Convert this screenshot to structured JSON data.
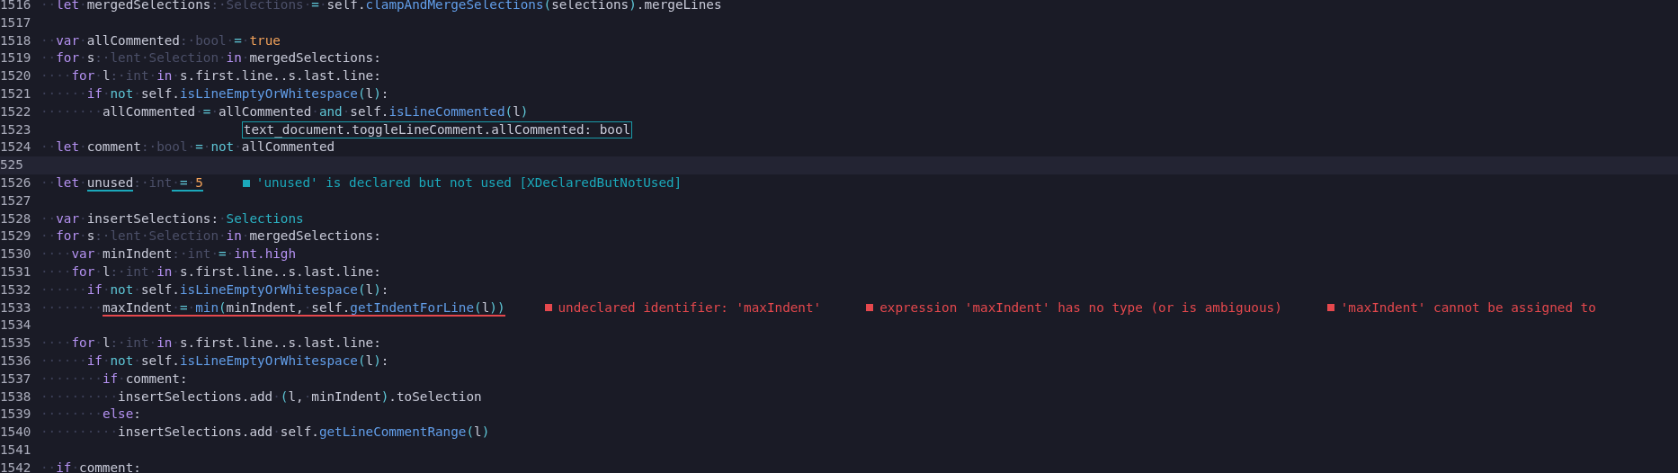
{
  "editor": {
    "lines": [
      {
        "number": "1516",
        "current": false,
        "tokens": [
          {
            "kind": "ws",
            "text": "··"
          },
          {
            "kind": "kw",
            "text": "let"
          },
          {
            "kind": "ws",
            "text": "·"
          },
          {
            "kind": "id",
            "text": "mergedSelections"
          },
          {
            "kind": "type",
            "text": ":·Selections"
          },
          {
            "kind": "ws",
            "text": "·"
          },
          {
            "kind": "op",
            "text": "="
          },
          {
            "kind": "ws",
            "text": "·"
          },
          {
            "kind": "id",
            "text": "self."
          },
          {
            "kind": "fn",
            "text": "clampAndMergeSelections"
          },
          {
            "kind": "op",
            "text": "("
          },
          {
            "kind": "id",
            "text": "selections"
          },
          {
            "kind": "op",
            "text": ")"
          },
          {
            "kind": "id",
            "text": ".mergeLines"
          }
        ]
      },
      {
        "number": "1517",
        "current": false
      },
      {
        "number": "1518",
        "current": false,
        "tokens": [
          {
            "kind": "ws",
            "text": "··"
          },
          {
            "kind": "kw",
            "text": "var"
          },
          {
            "kind": "ws",
            "text": "·"
          },
          {
            "kind": "id",
            "text": "allCommented"
          },
          {
            "kind": "type",
            "text": ":·bool"
          },
          {
            "kind": "ws",
            "text": "·"
          },
          {
            "kind": "op",
            "text": "="
          },
          {
            "kind": "ws",
            "text": "·"
          },
          {
            "kind": "lit",
            "text": "true"
          }
        ]
      },
      {
        "number": "1519",
        "current": false,
        "tokens": [
          {
            "kind": "ws",
            "text": "··"
          },
          {
            "kind": "kw",
            "text": "for"
          },
          {
            "kind": "ws",
            "text": "·"
          },
          {
            "kind": "id",
            "text": "s"
          },
          {
            "kind": "type",
            "text": ":·lent·Selection"
          },
          {
            "kind": "ws",
            "text": "·"
          },
          {
            "kind": "kw",
            "text": "in"
          },
          {
            "kind": "ws",
            "text": "·"
          },
          {
            "kind": "id",
            "text": "mergedSelections:"
          }
        ]
      },
      {
        "number": "1520",
        "current": false,
        "tokens": [
          {
            "kind": "ws",
            "text": "····"
          },
          {
            "kind": "kw",
            "text": "for"
          },
          {
            "kind": "ws",
            "text": "·"
          },
          {
            "kind": "id",
            "text": "l"
          },
          {
            "kind": "type",
            "text": ":·int"
          },
          {
            "kind": "ws",
            "text": "·"
          },
          {
            "kind": "kw",
            "text": "in"
          },
          {
            "kind": "ws",
            "text": "·"
          },
          {
            "kind": "id",
            "text": "s.first.line..s.last.line:"
          }
        ]
      },
      {
        "number": "1521",
        "current": false,
        "tokens": [
          {
            "kind": "ws",
            "text": "······"
          },
          {
            "kind": "kw",
            "text": "if"
          },
          {
            "kind": "ws",
            "text": "·"
          },
          {
            "kind": "op",
            "text": "not"
          },
          {
            "kind": "ws",
            "text": "·"
          },
          {
            "kind": "id",
            "text": "self."
          },
          {
            "kind": "fn",
            "text": "isLineEmptyOrWhitespace"
          },
          {
            "kind": "op",
            "text": "("
          },
          {
            "kind": "id",
            "text": "l"
          },
          {
            "kind": "op",
            "text": ")"
          },
          {
            "kind": "id",
            "text": ":"
          }
        ]
      },
      {
        "number": "1522",
        "current": false,
        "tokens": [
          {
            "kind": "ws",
            "text": "········"
          },
          {
            "kind": "id",
            "text": "allCommented"
          },
          {
            "kind": "ws",
            "text": "·"
          },
          {
            "kind": "op",
            "text": "="
          },
          {
            "kind": "ws",
            "text": "·"
          },
          {
            "kind": "id",
            "text": "allCommented"
          },
          {
            "kind": "ws",
            "text": "·"
          },
          {
            "kind": "op",
            "text": "and"
          },
          {
            "kind": "ws",
            "text": "·"
          },
          {
            "kind": "id",
            "text": "self."
          },
          {
            "kind": "fn",
            "text": "isLineCommented"
          },
          {
            "kind": "op",
            "text": "("
          },
          {
            "kind": "id",
            "text": "l"
          },
          {
            "kind": "op",
            "text": ")"
          }
        ]
      },
      {
        "number": "1523",
        "current": false,
        "hint": "text_document.toggleLineComment.allCommented: bool"
      },
      {
        "number": "1524",
        "current": false,
        "tokens": [
          {
            "kind": "ws",
            "text": "··"
          },
          {
            "kind": "kw",
            "text": "let"
          },
          {
            "kind": "ws",
            "text": "·"
          },
          {
            "kind": "id",
            "text": "comment"
          },
          {
            "kind": "type",
            "text": ":·bool"
          },
          {
            "kind": "ws",
            "text": "·"
          },
          {
            "kind": "op",
            "text": "="
          },
          {
            "kind": "ws",
            "text": "·"
          },
          {
            "kind": "op",
            "text": "not"
          },
          {
            "kind": "ws",
            "text": "·"
          },
          {
            "kind": "id",
            "text": "allCommented"
          }
        ]
      },
      {
        "number": "525",
        "current": true
      },
      {
        "number": "1526",
        "current": false,
        "tokens": [
          {
            "kind": "ws",
            "text": "··",
            "underlined": false
          },
          {
            "kind": "kw",
            "text": "let",
            "underlined": false
          },
          {
            "kind": "ws",
            "text": "·",
            "underlined": false
          },
          {
            "kind": "id",
            "text": "unused",
            "underlined": true
          },
          {
            "kind": "type",
            "text": ":·int",
            "underlined": false
          },
          {
            "kind": "ws",
            "text": "·",
            "underlined": true
          },
          {
            "kind": "op",
            "text": "=",
            "underlined": true
          },
          {
            "kind": "ws",
            "text": "·",
            "underlined": true
          },
          {
            "kind": "lit",
            "text": "5",
            "underlined": true
          }
        ],
        "diagnostics": [
          {
            "kind": "warning",
            "message": "'unused' is declared but not used [XDeclaredButNotUsed]"
          }
        ]
      },
      {
        "number": "1527",
        "current": false
      },
      {
        "number": "1528",
        "current": false,
        "tokens": [
          {
            "kind": "ws",
            "text": "··"
          },
          {
            "kind": "kw",
            "text": "var"
          },
          {
            "kind": "ws",
            "text": "·"
          },
          {
            "kind": "id",
            "text": "insertSelections:"
          },
          {
            "kind": "ws",
            "text": "·"
          },
          {
            "kind": "cls",
            "text": "Selections"
          }
        ]
      },
      {
        "number": "1529",
        "current": false,
        "tokens": [
          {
            "kind": "ws",
            "text": "··"
          },
          {
            "kind": "kw",
            "text": "for"
          },
          {
            "kind": "ws",
            "text": "·"
          },
          {
            "kind": "id",
            "text": "s"
          },
          {
            "kind": "type",
            "text": ":·lent·Selection"
          },
          {
            "kind": "ws",
            "text": "·"
          },
          {
            "kind": "kw",
            "text": "in"
          },
          {
            "kind": "ws",
            "text": "·"
          },
          {
            "kind": "id",
            "text": "mergedSelections:"
          }
        ]
      },
      {
        "number": "1530",
        "current": false,
        "tokens": [
          {
            "kind": "ws",
            "text": "····"
          },
          {
            "kind": "kw",
            "text": "var"
          },
          {
            "kind": "ws",
            "text": "·"
          },
          {
            "kind": "id",
            "text": "minIndent"
          },
          {
            "kind": "type",
            "text": ":·int"
          },
          {
            "kind": "ws",
            "text": "·"
          },
          {
            "kind": "op",
            "text": "="
          },
          {
            "kind": "ws",
            "text": "·"
          },
          {
            "kind": "kw",
            "text": "int.high"
          }
        ]
      },
      {
        "number": "1531",
        "current": false,
        "tokens": [
          {
            "kind": "ws",
            "text": "····"
          },
          {
            "kind": "kw",
            "text": "for"
          },
          {
            "kind": "ws",
            "text": "·"
          },
          {
            "kind": "id",
            "text": "l"
          },
          {
            "kind": "type",
            "text": ":·int"
          },
          {
            "kind": "ws",
            "text": "·"
          },
          {
            "kind": "kw",
            "text": "in"
          },
          {
            "kind": "ws",
            "text": "·"
          },
          {
            "kind": "id",
            "text": "s.first.line..s.last.line:"
          }
        ]
      },
      {
        "number": "1532",
        "current": false,
        "tokens": [
          {
            "kind": "ws",
            "text": "······"
          },
          {
            "kind": "kw",
            "text": "if"
          },
          {
            "kind": "ws",
            "text": "·"
          },
          {
            "kind": "op",
            "text": "not"
          },
          {
            "kind": "ws",
            "text": "·"
          },
          {
            "kind": "id",
            "text": "self."
          },
          {
            "kind": "fn",
            "text": "isLineEmptyOrWhitespace"
          },
          {
            "kind": "op",
            "text": "("
          },
          {
            "kind": "id",
            "text": "l"
          },
          {
            "kind": "op",
            "text": ")"
          },
          {
            "kind": "id",
            "text": ":"
          }
        ]
      },
      {
        "number": "1533",
        "current": false,
        "tokens": [
          {
            "kind": "ws",
            "text": "········",
            "underlined": false
          },
          {
            "kind": "id",
            "text": "maxIndent",
            "underlined": true
          },
          {
            "kind": "ws",
            "text": "·",
            "underlined": true
          },
          {
            "kind": "op",
            "text": "=",
            "underlined": true
          },
          {
            "kind": "ws",
            "text": "·",
            "underlined": true
          },
          {
            "kind": "fn",
            "text": "min",
            "underlined": true
          },
          {
            "kind": "op",
            "text": "(",
            "underlined": true
          },
          {
            "kind": "id",
            "text": "minIndent,",
            "underlined": true
          },
          {
            "kind": "ws",
            "text": "·",
            "underlined": true
          },
          {
            "kind": "id",
            "text": "self.",
            "underlined": true
          },
          {
            "kind": "fn",
            "text": "getIndentForLine",
            "underlined": true
          },
          {
            "kind": "op",
            "text": "(",
            "underlined": true
          },
          {
            "kind": "id",
            "text": "l",
            "underlined": true
          },
          {
            "kind": "op",
            "text": "))",
            "underlined": true
          }
        ],
        "diagnostics": [
          {
            "kind": "error",
            "message": "undeclared identifier: 'maxIndent'"
          },
          {
            "kind": "error",
            "message": "expression 'maxIndent' has no type (or is ambiguous)"
          },
          {
            "kind": "error",
            "message": "'maxIndent' cannot be assigned to"
          }
        ]
      },
      {
        "number": "1534",
        "current": false
      },
      {
        "number": "1535",
        "current": false,
        "tokens": [
          {
            "kind": "ws",
            "text": "····"
          },
          {
            "kind": "kw",
            "text": "for"
          },
          {
            "kind": "ws",
            "text": "·"
          },
          {
            "kind": "id",
            "text": "l"
          },
          {
            "kind": "type",
            "text": ":·int"
          },
          {
            "kind": "ws",
            "text": "·"
          },
          {
            "kind": "kw",
            "text": "in"
          },
          {
            "kind": "ws",
            "text": "·"
          },
          {
            "kind": "id",
            "text": "s.first.line..s.last.line:"
          }
        ]
      },
      {
        "number": "1536",
        "current": false,
        "tokens": [
          {
            "kind": "ws",
            "text": "······"
          },
          {
            "kind": "kw",
            "text": "if"
          },
          {
            "kind": "ws",
            "text": "·"
          },
          {
            "kind": "op",
            "text": "not"
          },
          {
            "kind": "ws",
            "text": "·"
          },
          {
            "kind": "id",
            "text": "self."
          },
          {
            "kind": "fn",
            "text": "isLineEmptyOrWhitespace"
          },
          {
            "kind": "op",
            "text": "("
          },
          {
            "kind": "id",
            "text": "l"
          },
          {
            "kind": "op",
            "text": ")"
          },
          {
            "kind": "id",
            "text": ":"
          }
        ]
      },
      {
        "number": "1537",
        "current": false,
        "tokens": [
          {
            "kind": "ws",
            "text": "········"
          },
          {
            "kind": "kw",
            "text": "if"
          },
          {
            "kind": "ws",
            "text": "·"
          },
          {
            "kind": "id",
            "text": "comment:"
          }
        ]
      },
      {
        "number": "1538",
        "current": false,
        "tokens": [
          {
            "kind": "ws",
            "text": "··········"
          },
          {
            "kind": "id",
            "text": "insertSelections.add"
          },
          {
            "kind": "ws",
            "text": "·"
          },
          {
            "kind": "op",
            "text": "("
          },
          {
            "kind": "id",
            "text": "l,"
          },
          {
            "kind": "ws",
            "text": "·"
          },
          {
            "kind": "id",
            "text": "minIndent"
          },
          {
            "kind": "op",
            "text": ")"
          },
          {
            "kind": "id",
            "text": ".toSelection"
          }
        ]
      },
      {
        "number": "1539",
        "current": false,
        "tokens": [
          {
            "kind": "ws",
            "text": "········"
          },
          {
            "kind": "kw",
            "text": "else"
          },
          {
            "kind": "id",
            "text": ":"
          }
        ]
      },
      {
        "number": "1540",
        "current": false,
        "tokens": [
          {
            "kind": "ws",
            "text": "··········"
          },
          {
            "kind": "id",
            "text": "insertSelections.add"
          },
          {
            "kind": "ws",
            "text": "·"
          },
          {
            "kind": "id",
            "text": "self."
          },
          {
            "kind": "fn",
            "text": "getLineCommentRange"
          },
          {
            "kind": "op",
            "text": "("
          },
          {
            "kind": "id",
            "text": "l"
          },
          {
            "kind": "op",
            "text": ")"
          }
        ]
      },
      {
        "number": "1541",
        "current": false
      },
      {
        "number": "1542",
        "current": false,
        "tokens": [
          {
            "kind": "ws",
            "text": "··"
          },
          {
            "kind": "kw",
            "text": "if"
          },
          {
            "kind": "ws",
            "text": "·"
          },
          {
            "kind": "id",
            "text": "comment:"
          }
        ]
      }
    ]
  }
}
